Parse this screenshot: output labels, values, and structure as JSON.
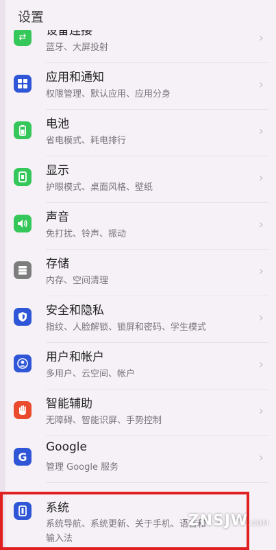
{
  "header": {
    "title": "设置"
  },
  "items": [
    {
      "label": "设备连接",
      "sub": "蓝牙、大屏投射",
      "icon": "link-icon",
      "color": "#35c759"
    },
    {
      "label": "应用和通知",
      "sub": "权限管理、默认应用、应用分身",
      "icon": "apps-icon",
      "color": "#2e56d6"
    },
    {
      "label": "电池",
      "sub": "省电模式、耗电排行",
      "icon": "battery-icon",
      "color": "#35c759"
    },
    {
      "label": "显示",
      "sub": "护眼模式、桌面风格、壁纸",
      "icon": "display-icon",
      "color": "#35c759"
    },
    {
      "label": "声音",
      "sub": "免打扰、铃声、振动",
      "icon": "sound-icon",
      "color": "#35c759"
    },
    {
      "label": "存储",
      "sub": "内存、空间清理",
      "icon": "storage-icon",
      "color": "#7d7d7d"
    },
    {
      "label": "安全和隐私",
      "sub": "指纹、人脸解锁、锁屏和密码、学生模式",
      "icon": "shield-icon",
      "color": "#2e56d6"
    },
    {
      "label": "用户和帐户",
      "sub": "多用户、云空间、帐户",
      "icon": "user-icon",
      "color": "#2e56d6"
    },
    {
      "label": "智能辅助",
      "sub": "无障碍、智能识屏、手势控制",
      "icon": "hand-icon",
      "color": "#ea4a2d"
    },
    {
      "label": "Google",
      "sub": "管理 Google 服务",
      "icon": "google-icon",
      "color": "#2e56d6"
    },
    {
      "label": "系统",
      "sub": "系统导航、系统更新、关于手机、语言和输入法",
      "icon": "phone-icon",
      "color": "#2e56d6"
    }
  ],
  "watermark": {
    "text": "ZNSJW",
    "suffix": ".COM"
  }
}
